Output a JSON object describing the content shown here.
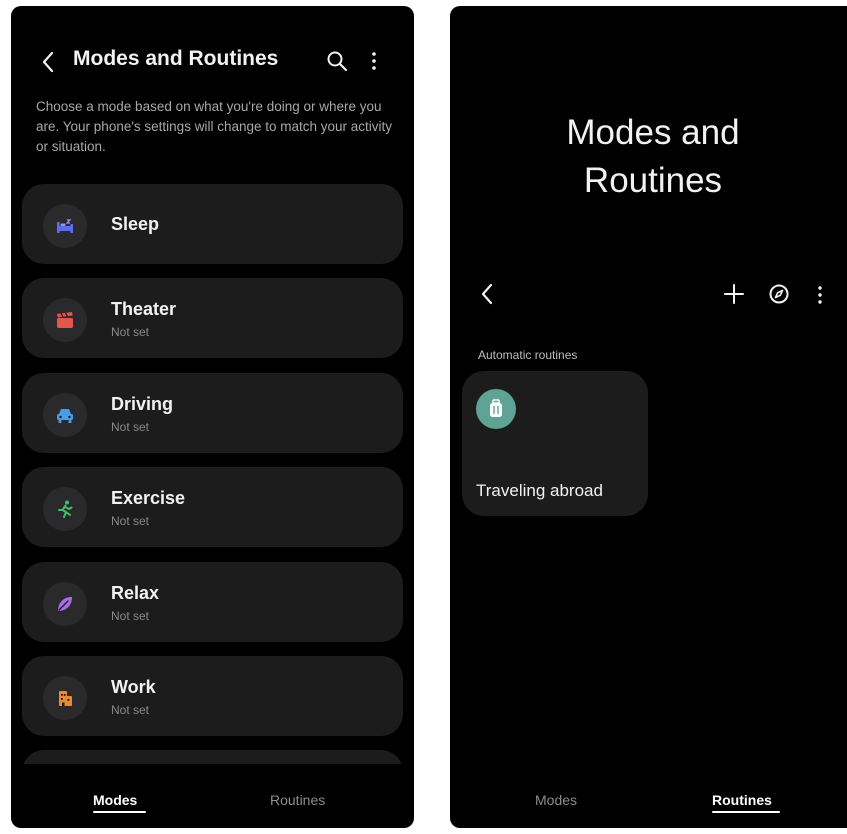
{
  "modes_screen": {
    "header": {
      "title": "Modes and Routines"
    },
    "description": "Choose a mode based on what you're doing or where you are. Your phone's settings will change to match your activity or situation.",
    "modes": [
      {
        "name": "Sleep",
        "status": "",
        "icon": "sleep-bed-icon",
        "color": "#5b6ef0"
      },
      {
        "name": "Theater",
        "status": "Not set",
        "icon": "theater-clapper-icon",
        "color": "#e2574c"
      },
      {
        "name": "Driving",
        "status": "Not set",
        "icon": "car-icon",
        "color": "#4a9ee6"
      },
      {
        "name": "Exercise",
        "status": "Not set",
        "icon": "running-icon",
        "color": "#3fbf6a"
      },
      {
        "name": "Relax",
        "status": "Not set",
        "icon": "leaf-icon",
        "color": "#a96de8"
      },
      {
        "name": "Work",
        "status": "Not set",
        "icon": "building-icon",
        "color": "#e98a3a"
      }
    ],
    "tabs": {
      "modes": "Modes",
      "routines": "Routines",
      "active": "Modes"
    }
  },
  "routines_screen": {
    "title": "Modes and Routines",
    "section_label": "Automatic routines",
    "routines": [
      {
        "name": "Traveling abroad",
        "icon": "luggage-icon",
        "color": "#5fa394"
      }
    ],
    "tabs": {
      "modes": "Modes",
      "routines": "Routines",
      "active": "Routines"
    }
  }
}
